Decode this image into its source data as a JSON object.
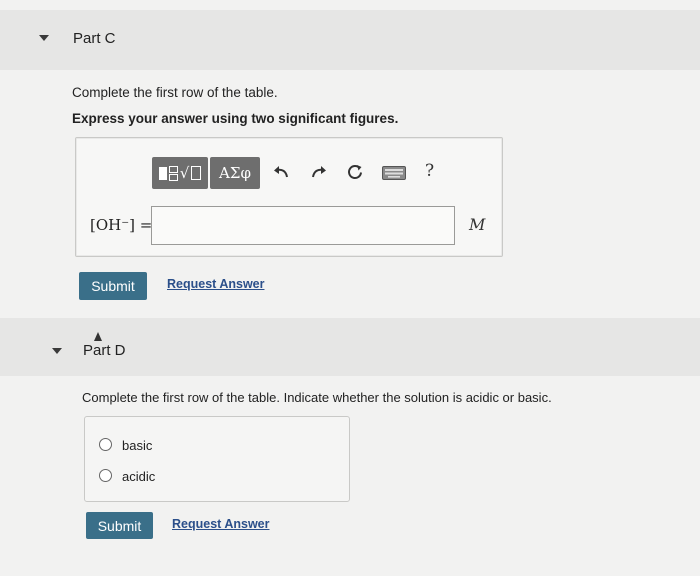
{
  "part_c": {
    "title": "Part C",
    "instruction": "Complete the first row of the table.",
    "emphasis": "Express your answer using two significant figures.",
    "toolbar": {
      "template_button_icon": "fraction-sqrt-template-icon",
      "symbols_label": "ΑΣφ",
      "undo_icon": "undo-arrow-icon",
      "redo_icon": "redo-arrow-icon",
      "reset_icon": "reset-icon",
      "keyboard_icon": "keyboard-icon",
      "help_label": "?"
    },
    "input_label": "[OH⁻] =",
    "input_value": "",
    "unit": "M",
    "submit_label": "Submit",
    "request_label": "Request Answer"
  },
  "part_d": {
    "title": "Part D",
    "instruction": "Complete the first row of the table. Indicate whether the solution is acidic or basic.",
    "options": [
      {
        "label": "basic"
      },
      {
        "label": "acidic"
      }
    ],
    "submit_label": "Submit",
    "request_label": "Request Answer"
  },
  "colors": {
    "submit_bg": "#3a6f89",
    "link": "#2b4f8a",
    "toolbar_btn": "#6e6e6e"
  }
}
